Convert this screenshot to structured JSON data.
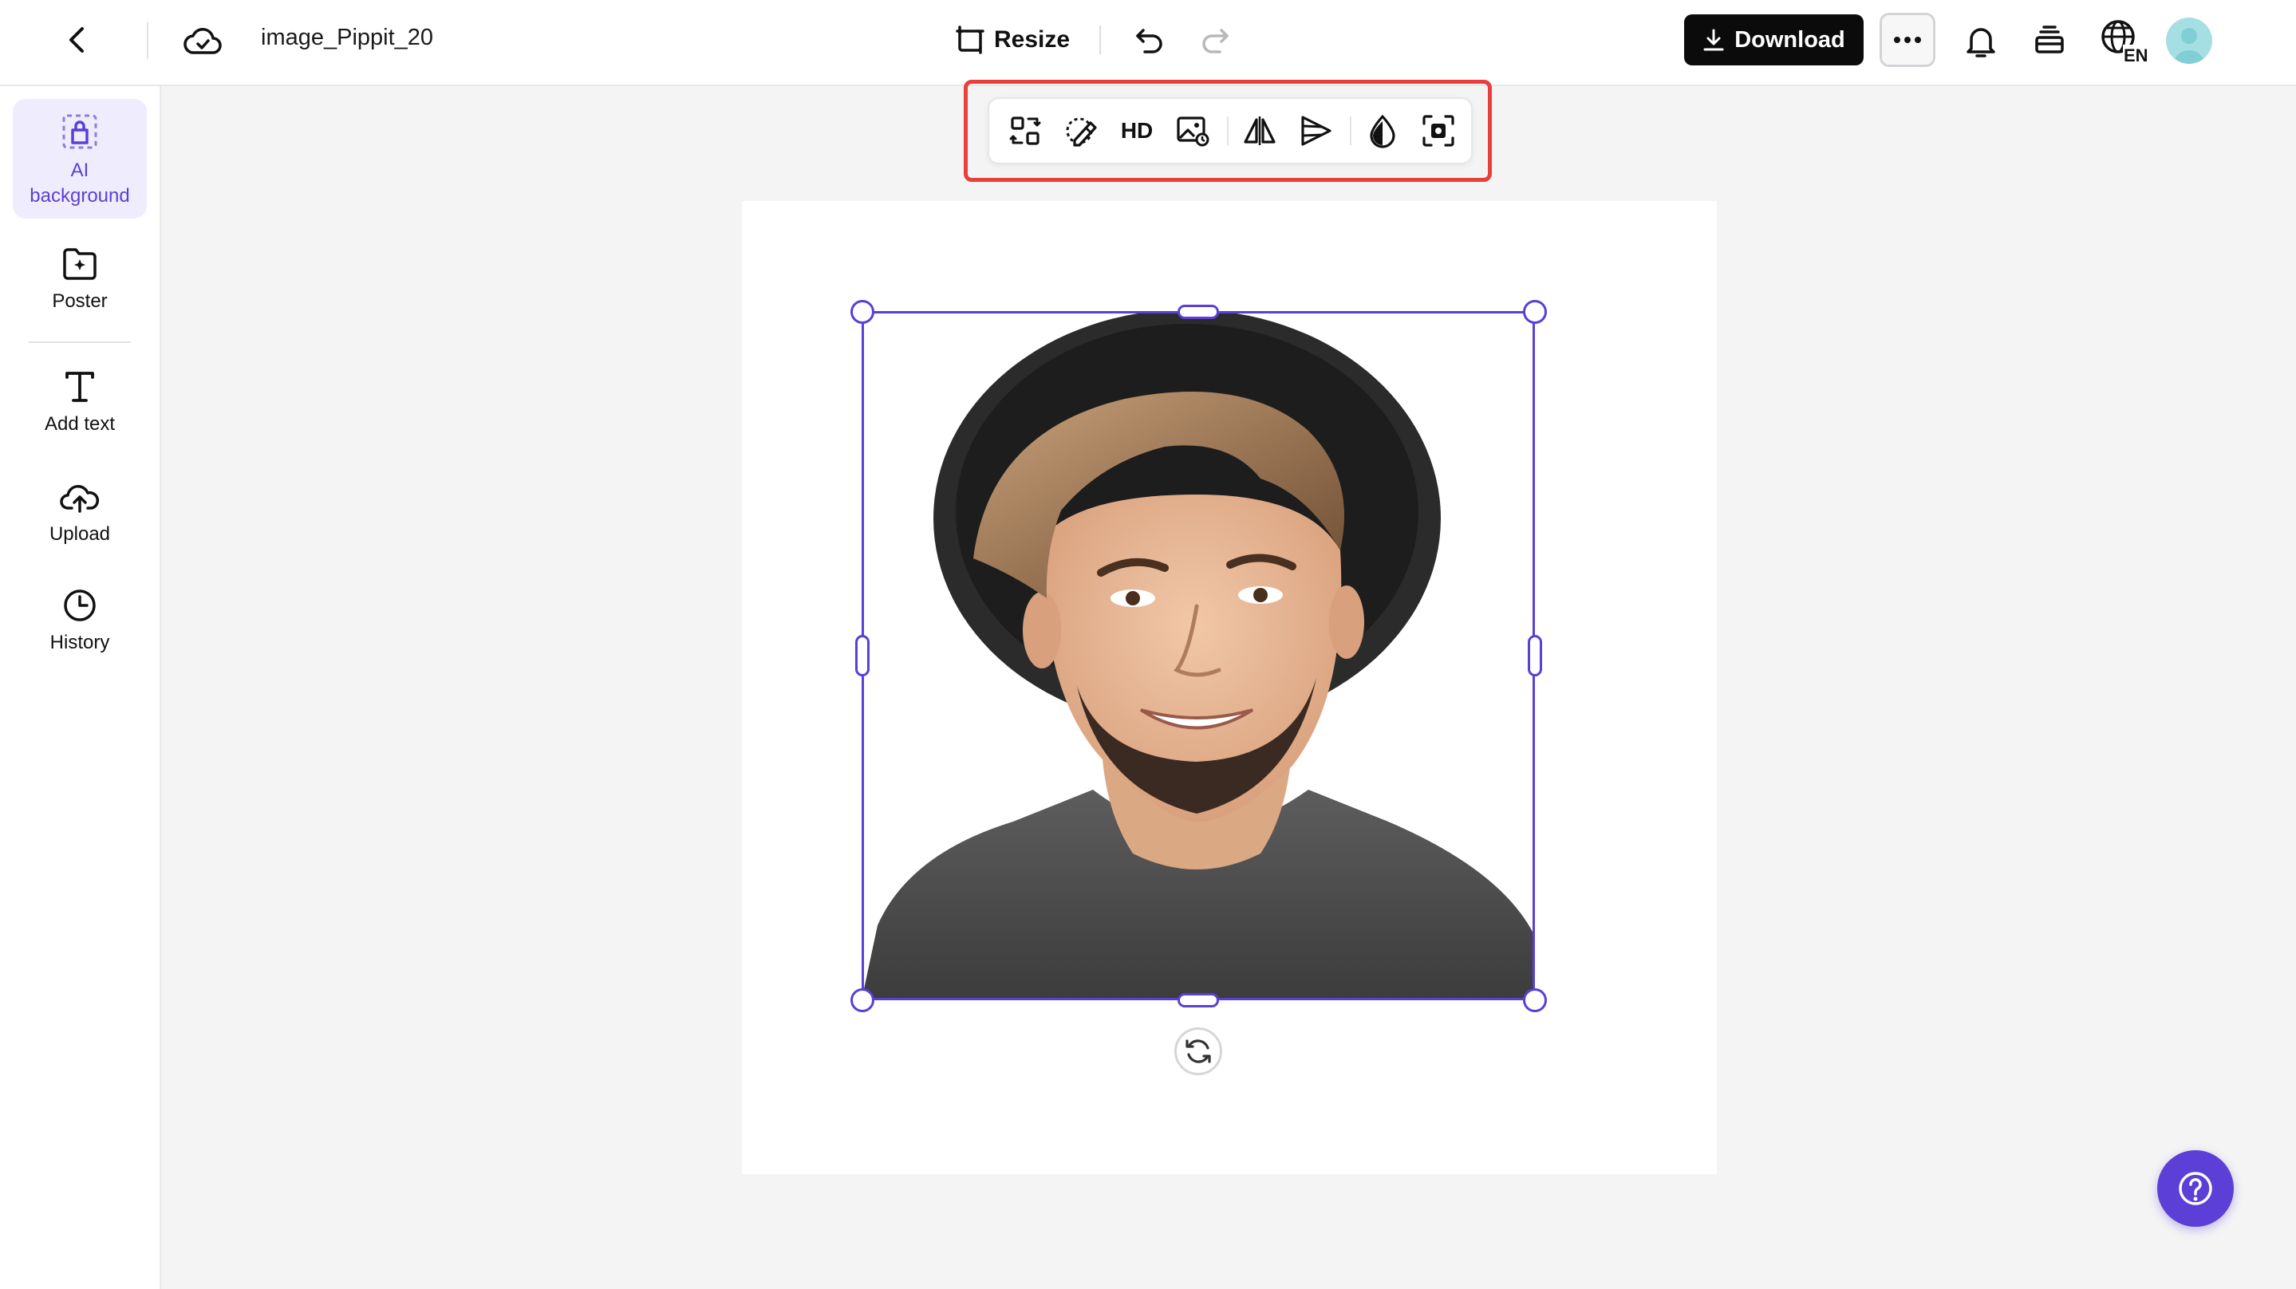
{
  "header": {
    "file_name": "image_Pippit_20",
    "resize_label": "Resize",
    "download_label": "Download",
    "language_code": "EN"
  },
  "sidebar": {
    "items": [
      {
        "label": "AI background",
        "icon": "ai-background-icon",
        "active": true
      },
      {
        "label": "Poster",
        "icon": "poster-icon"
      },
      {
        "label": "Add text",
        "icon": "text-icon"
      },
      {
        "label": "Upload",
        "icon": "upload-icon"
      },
      {
        "label": "History",
        "icon": "history-icon"
      }
    ]
  },
  "toolbar": {
    "hd_label": "HD",
    "tools": [
      "replace-icon",
      "magic-eraser-icon",
      "hd-upscale",
      "image-edit-icon",
      "flip-icon",
      "perspective-icon",
      "opacity-icon",
      "focus-icon"
    ]
  },
  "colors": {
    "accent": "#5b3fd6",
    "highlight": "#e8403a",
    "download_bg": "#0b0b0b"
  }
}
